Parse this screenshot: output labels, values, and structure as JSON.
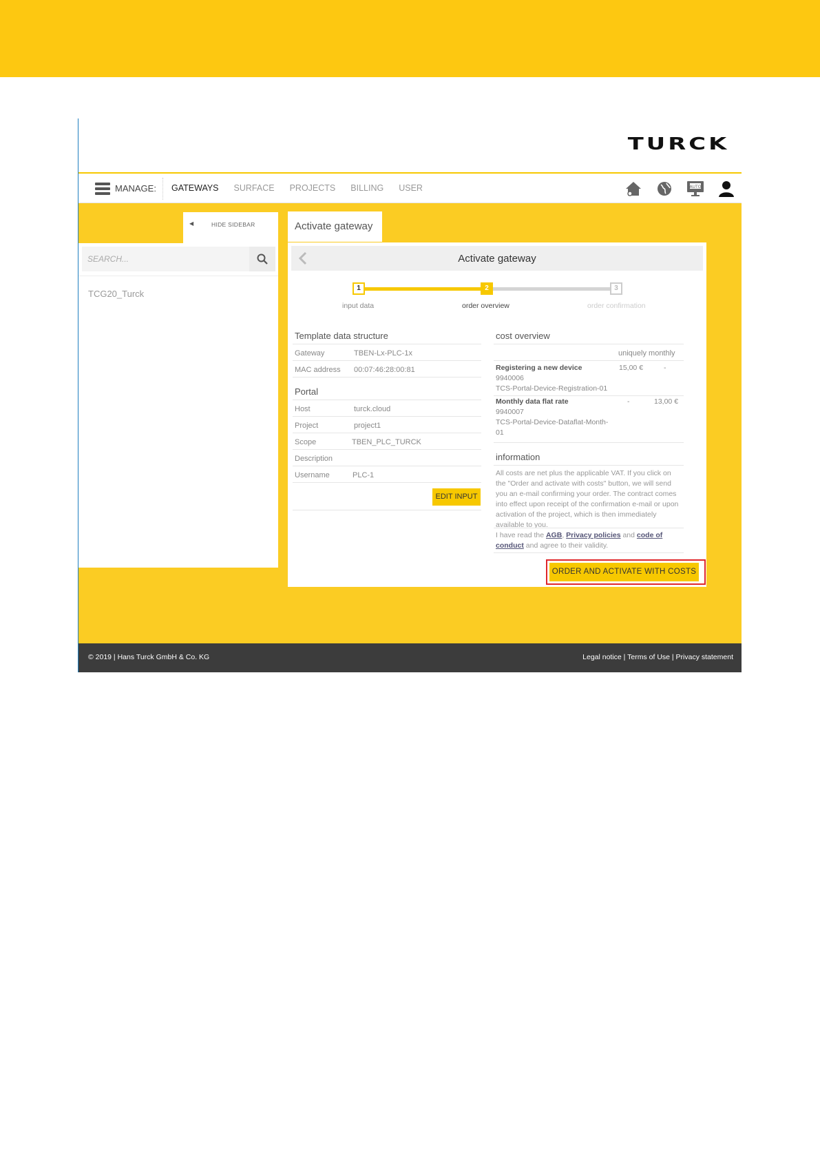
{
  "brand": {
    "logo_text": "TURCK",
    "accent": "#f7c800",
    "band": "#fdc811"
  },
  "nav": {
    "manage_label": "MANAGE:",
    "items": [
      {
        "label": "GATEWAYS",
        "active": true
      },
      {
        "label": "SURFACE",
        "active": false
      },
      {
        "label": "PROJECTS",
        "active": false
      },
      {
        "label": "BILLING",
        "active": false
      },
      {
        "label": "USER",
        "active": false
      }
    ],
    "icons": [
      "home-icon",
      "globe-icon",
      "auto-monitor-icon",
      "user-icon"
    ]
  },
  "sidebar": {
    "toggle_label": "HIDE SIDEBAR",
    "search_placeholder": "SEARCH...",
    "items": [
      "TCG20_Turck"
    ]
  },
  "content": {
    "tab_label": "Activate gateway",
    "header_title": "Activate gateway",
    "steps": [
      {
        "number": "1",
        "label": "input data",
        "state": "done"
      },
      {
        "number": "2",
        "label": "order overview",
        "state": "current"
      },
      {
        "number": "3",
        "label": "order confirmation",
        "state": "future"
      }
    ],
    "template": {
      "title": "Template data structure",
      "rows": [
        {
          "key": "Gateway",
          "value": "TBEN-Lx-PLC-1x"
        },
        {
          "key": "MAC address",
          "value": "00:07:46:28:00:81"
        }
      ]
    },
    "portal": {
      "title": "Portal",
      "rows": [
        {
          "key": "Host",
          "value": "turck.cloud"
        },
        {
          "key": "Project",
          "value": "project1"
        },
        {
          "key": "Scope",
          "value": "TBEN_PLC_TURCK"
        },
        {
          "key": "Description",
          "value": ""
        },
        {
          "key": "Username",
          "value": "PLC-1"
        }
      ]
    },
    "edit_button": "EDIT INPUT",
    "cost": {
      "title": "cost overview",
      "header": "uniquely monthly",
      "items": [
        {
          "name": "Registering a new device",
          "number": "9940006",
          "code": "TCS-Portal-Device-Registration-01",
          "uniquely": "15,00 €",
          "monthly": "-"
        },
        {
          "name": "Monthly data flat rate",
          "number": "9940007",
          "code_line1": "TCS-Portal-Device-Dataflat-Month-",
          "code_line2": "01",
          "uniquely": "-",
          "monthly": "13,00 €"
        }
      ]
    },
    "information": {
      "title": "information",
      "text": "All costs are net plus the applicable VAT. If you click on the \"Order and activate with costs\" button, we will send you an e-mail confirming your order. The contract comes into effect upon receipt of the confirmation e-mail or upon activation of the project, which is then immediately available to you.",
      "agree_prefix": "I have read the ",
      "agb": "AGB",
      "comma": ", ",
      "privacy": "Privacy policies",
      "and": " and ",
      "conduct": "code of conduct",
      "agree_suffix": " and agree to their validity."
    },
    "order_button": "ORDER AND ACTIVATE WITH COSTS"
  },
  "footer": {
    "copyright": "© 2019 | Hans Turck GmbH & Co. KG",
    "links": "Legal notice | Terms of Use | Privacy statement"
  }
}
